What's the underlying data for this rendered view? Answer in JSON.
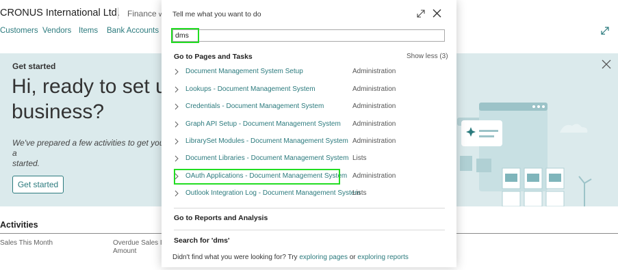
{
  "app": {
    "company": "CRONUS International Ltd.",
    "role_menu": "Finance",
    "nav_links": [
      "Customers",
      "Vendors",
      "Items",
      "Bank Accounts"
    ]
  },
  "banner": {
    "heading": "Get started",
    "hero_text": "Hi, ready to set up business?",
    "hero_line1": "Hi, ready to set u",
    "hero_line2": "business?",
    "description_line1": "We've prepared a few activities to get you a",
    "description_line2": "started.",
    "button_label": "Get started"
  },
  "activities": {
    "heading": "Activities",
    "col1": "Sales This Month",
    "col2_line1": "Overdue Sales Inv",
    "col2_line2": "Amount"
  },
  "dialog": {
    "title": "Tell me what you want to do",
    "search_value": "dms",
    "pages_section_label": "Go to Pages and Tasks",
    "show_less_label": "Show less (3)",
    "results": [
      {
        "name": "Document Management System Setup",
        "category": "Administration"
      },
      {
        "name": "Lookups - Document Management System",
        "category": "Administration"
      },
      {
        "name": "Credentials - Document Management System",
        "category": "Administration"
      },
      {
        "name": "Graph API Setup - Document Management System",
        "category": "Administration"
      },
      {
        "name": "LibrarySet Modules - Document Management System",
        "category": "Administration"
      },
      {
        "name": "Document Libraries - Document Management System",
        "category": "Lists"
      },
      {
        "name": "OAuth Applications - Document Management System",
        "category": "Administration"
      },
      {
        "name": "Outlook Integration Log - Document Management System",
        "category": "Lists"
      }
    ],
    "reports_section_label": "Go to Reports and Analysis",
    "search_for_label": "Search for 'dms'",
    "footer_text": "Didn't find what you were looking for? Try",
    "footer_link1": "exploring pages",
    "footer_or": "or",
    "footer_link2": "exploring reports"
  },
  "colors": {
    "accent": "#2b7a7d",
    "highlight": "#22dd22",
    "banner_bg": "#dbeaec"
  }
}
